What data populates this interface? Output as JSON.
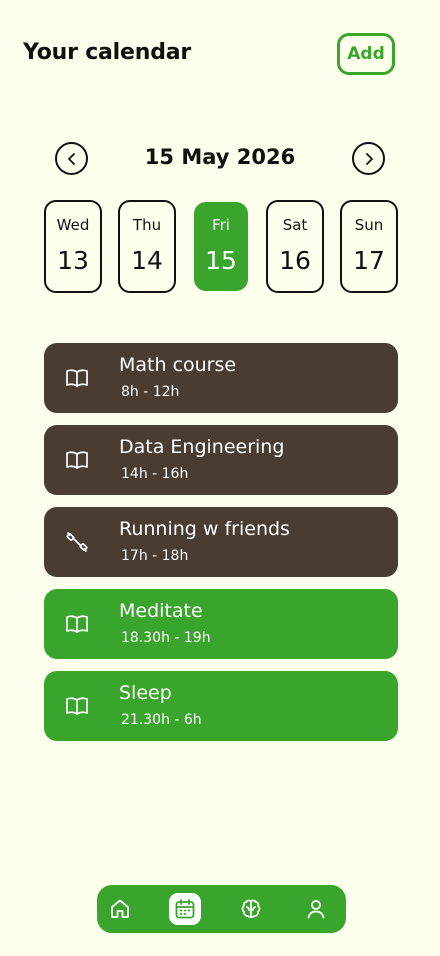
{
  "header": {
    "title": "Your calendar",
    "add_label": "Add"
  },
  "date_nav": {
    "title": "15 May 2026",
    "prev_icon": "chevron-left-icon",
    "next_icon": "chevron-right-icon"
  },
  "days": [
    {
      "name": "Wed",
      "num": "13",
      "selected": false
    },
    {
      "name": "Thu",
      "num": "14",
      "selected": false
    },
    {
      "name": "Fri",
      "num": "15",
      "selected": true
    },
    {
      "name": "Sat",
      "num": "16",
      "selected": false
    },
    {
      "name": "Sun",
      "num": "17",
      "selected": false
    }
  ],
  "events": [
    {
      "title": "Math course",
      "time": "8h - 12h",
      "icon": "book-icon",
      "color": "#4A3C31"
    },
    {
      "title": "Data Engineering",
      "time": "14h - 16h",
      "icon": "book-icon",
      "color": "#4A3C31"
    },
    {
      "title": "Running w friends",
      "time": "17h - 18h",
      "icon": "dumbbell-icon",
      "color": "#4A3C31"
    },
    {
      "title": "Meditate",
      "time": "18.30h - 19h",
      "icon": "book-icon",
      "color": "#3AA52C"
    },
    {
      "title": "Sleep",
      "time": "21.30h - 6h",
      "icon": "book-icon",
      "color": "#3AA52C"
    }
  ],
  "bottom_nav": [
    {
      "icon": "home-icon",
      "active": false
    },
    {
      "icon": "calendar-icon",
      "active": true
    },
    {
      "icon": "brain-icon",
      "active": false
    },
    {
      "icon": "user-icon",
      "active": false
    }
  ],
  "colors": {
    "background": "#FDFEEC",
    "accent": "#3AA52C",
    "dark_card": "#4A3C31"
  }
}
